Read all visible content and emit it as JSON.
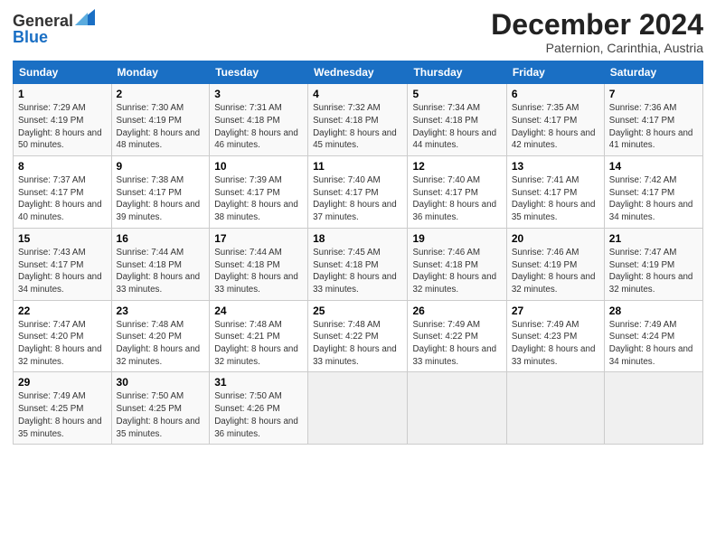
{
  "header": {
    "logo_general": "General",
    "logo_blue": "Blue",
    "month_title": "December 2024",
    "location": "Paternion, Carinthia, Austria"
  },
  "weekdays": [
    "Sunday",
    "Monday",
    "Tuesday",
    "Wednesday",
    "Thursday",
    "Friday",
    "Saturday"
  ],
  "weeks": [
    [
      {
        "day": "1",
        "sunrise": "7:29 AM",
        "sunset": "4:19 PM",
        "daylight": "8 hours and 50 minutes."
      },
      {
        "day": "2",
        "sunrise": "7:30 AM",
        "sunset": "4:19 PM",
        "daylight": "8 hours and 48 minutes."
      },
      {
        "day": "3",
        "sunrise": "7:31 AM",
        "sunset": "4:18 PM",
        "daylight": "8 hours and 46 minutes."
      },
      {
        "day": "4",
        "sunrise": "7:32 AM",
        "sunset": "4:18 PM",
        "daylight": "8 hours and 45 minutes."
      },
      {
        "day": "5",
        "sunrise": "7:34 AM",
        "sunset": "4:18 PM",
        "daylight": "8 hours and 44 minutes."
      },
      {
        "day": "6",
        "sunrise": "7:35 AM",
        "sunset": "4:17 PM",
        "daylight": "8 hours and 42 minutes."
      },
      {
        "day": "7",
        "sunrise": "7:36 AM",
        "sunset": "4:17 PM",
        "daylight": "8 hours and 41 minutes."
      }
    ],
    [
      {
        "day": "8",
        "sunrise": "7:37 AM",
        "sunset": "4:17 PM",
        "daylight": "8 hours and 40 minutes."
      },
      {
        "day": "9",
        "sunrise": "7:38 AM",
        "sunset": "4:17 PM",
        "daylight": "8 hours and 39 minutes."
      },
      {
        "day": "10",
        "sunrise": "7:39 AM",
        "sunset": "4:17 PM",
        "daylight": "8 hours and 38 minutes."
      },
      {
        "day": "11",
        "sunrise": "7:40 AM",
        "sunset": "4:17 PM",
        "daylight": "8 hours and 37 minutes."
      },
      {
        "day": "12",
        "sunrise": "7:40 AM",
        "sunset": "4:17 PM",
        "daylight": "8 hours and 36 minutes."
      },
      {
        "day": "13",
        "sunrise": "7:41 AM",
        "sunset": "4:17 PM",
        "daylight": "8 hours and 35 minutes."
      },
      {
        "day": "14",
        "sunrise": "7:42 AM",
        "sunset": "4:17 PM",
        "daylight": "8 hours and 34 minutes."
      }
    ],
    [
      {
        "day": "15",
        "sunrise": "7:43 AM",
        "sunset": "4:17 PM",
        "daylight": "8 hours and 34 minutes."
      },
      {
        "day": "16",
        "sunrise": "7:44 AM",
        "sunset": "4:18 PM",
        "daylight": "8 hours and 33 minutes."
      },
      {
        "day": "17",
        "sunrise": "7:44 AM",
        "sunset": "4:18 PM",
        "daylight": "8 hours and 33 minutes."
      },
      {
        "day": "18",
        "sunrise": "7:45 AM",
        "sunset": "4:18 PM",
        "daylight": "8 hours and 33 minutes."
      },
      {
        "day": "19",
        "sunrise": "7:46 AM",
        "sunset": "4:18 PM",
        "daylight": "8 hours and 32 minutes."
      },
      {
        "day": "20",
        "sunrise": "7:46 AM",
        "sunset": "4:19 PM",
        "daylight": "8 hours and 32 minutes."
      },
      {
        "day": "21",
        "sunrise": "7:47 AM",
        "sunset": "4:19 PM",
        "daylight": "8 hours and 32 minutes."
      }
    ],
    [
      {
        "day": "22",
        "sunrise": "7:47 AM",
        "sunset": "4:20 PM",
        "daylight": "8 hours and 32 minutes."
      },
      {
        "day": "23",
        "sunrise": "7:48 AM",
        "sunset": "4:20 PM",
        "daylight": "8 hours and 32 minutes."
      },
      {
        "day": "24",
        "sunrise": "7:48 AM",
        "sunset": "4:21 PM",
        "daylight": "8 hours and 32 minutes."
      },
      {
        "day": "25",
        "sunrise": "7:48 AM",
        "sunset": "4:22 PM",
        "daylight": "8 hours and 33 minutes."
      },
      {
        "day": "26",
        "sunrise": "7:49 AM",
        "sunset": "4:22 PM",
        "daylight": "8 hours and 33 minutes."
      },
      {
        "day": "27",
        "sunrise": "7:49 AM",
        "sunset": "4:23 PM",
        "daylight": "8 hours and 33 minutes."
      },
      {
        "day": "28",
        "sunrise": "7:49 AM",
        "sunset": "4:24 PM",
        "daylight": "8 hours and 34 minutes."
      }
    ],
    [
      {
        "day": "29",
        "sunrise": "7:49 AM",
        "sunset": "4:25 PM",
        "daylight": "8 hours and 35 minutes."
      },
      {
        "day": "30",
        "sunrise": "7:50 AM",
        "sunset": "4:25 PM",
        "daylight": "8 hours and 35 minutes."
      },
      {
        "day": "31",
        "sunrise": "7:50 AM",
        "sunset": "4:26 PM",
        "daylight": "8 hours and 36 minutes."
      },
      null,
      null,
      null,
      null
    ]
  ]
}
